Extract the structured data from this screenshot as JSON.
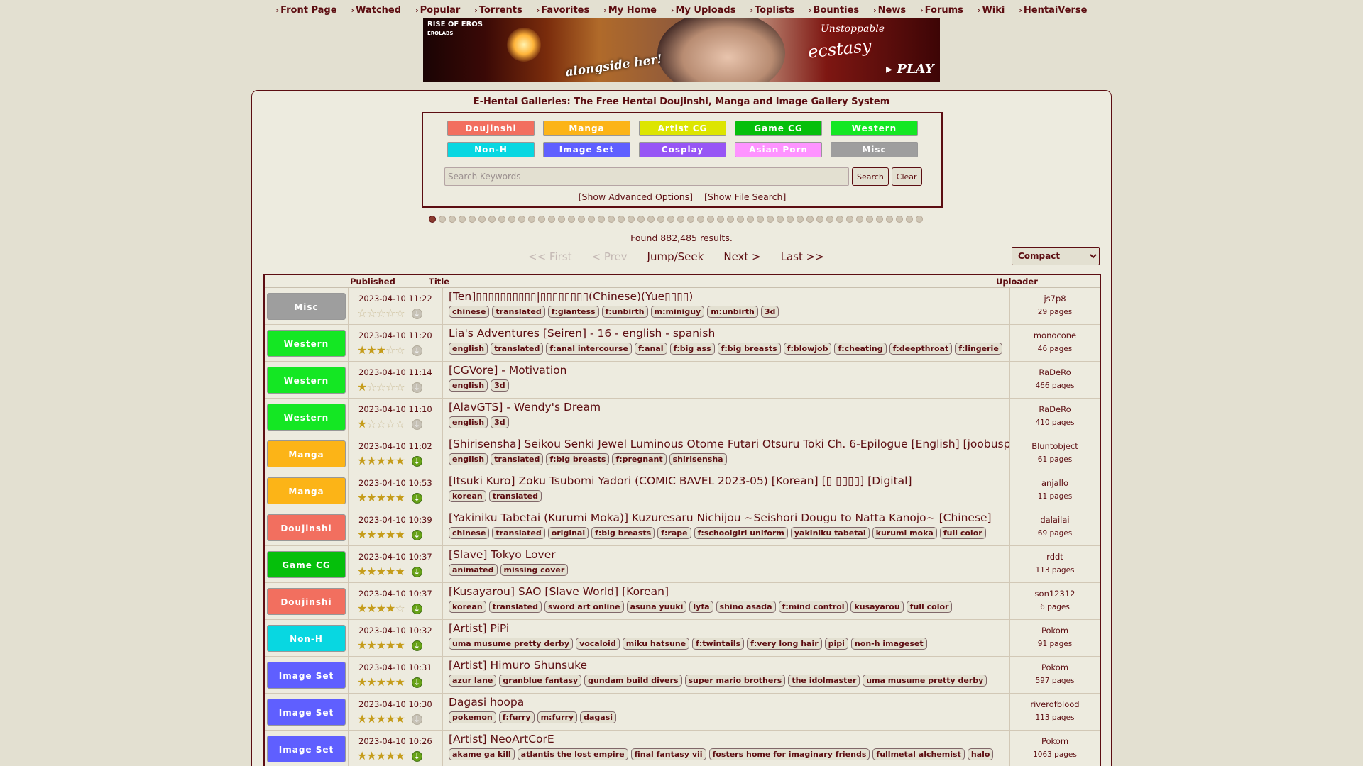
{
  "nav": [
    "Front Page",
    "Watched",
    "Popular",
    "Torrents",
    "Favorites",
    "My Home",
    "My Uploads",
    "Toplists",
    "Bounties",
    "News",
    "Forums",
    "Wiki",
    "HentaiVerse"
  ],
  "banner": {
    "logo": "RISE OF EROS",
    "logo_sub": "EROLABS",
    "line1": "alongside her!",
    "line2": "Unstoppable",
    "line3": "ecstasy",
    "play": "▸ PLAY"
  },
  "site_title": "E-Hentai Galleries: The Free Hentai Doujinshi, Manga and Image Gallery System",
  "categories": [
    {
      "label": "Doujinshi",
      "color": "#f26f5f"
    },
    {
      "label": "Manga",
      "color": "#fcb417"
    },
    {
      "label": "Artist CG",
      "color": "#dde500"
    },
    {
      "label": "Game CG",
      "color": "#05bf0b"
    },
    {
      "label": "Western",
      "color": "#14e723"
    },
    {
      "label": "Non-H",
      "color": "#08d7e1"
    },
    {
      "label": "Image Set",
      "color": "#5f5fff"
    },
    {
      "label": "Cosplay",
      "color": "#9755f5"
    },
    {
      "label": "Asian Porn",
      "color": "#fe93ff"
    },
    {
      "label": "Misc",
      "color": "#9e9e9e"
    }
  ],
  "search": {
    "placeholder": "Search Keywords",
    "value": "",
    "search_label": "Search",
    "clear_label": "Clear"
  },
  "links": {
    "advanced": "[Show Advanced Options]",
    "file": "[Show File Search]"
  },
  "found": "Found 882,485 results.",
  "pager": {
    "first": "<< First",
    "prev": "< Prev",
    "jump": "Jump/Seek",
    "next": "Next >",
    "last": "Last >>"
  },
  "display_mode": "Compact",
  "table_headers": {
    "published": "Published",
    "title": "Title",
    "uploader": "Uploader"
  },
  "cat_colors": {
    "Doujinshi": "#f26f5f",
    "Manga": "#fcb417",
    "Artist CG": "#dde500",
    "Game CG": "#05bf0b",
    "Western": "#14e723",
    "Non-H": "#08d7e1",
    "Image Set": "#5f5fff",
    "Cosplay": "#9755f5",
    "Asian Porn": "#fe93ff",
    "Misc": "#9e9e9e"
  },
  "galleries": [
    {
      "category": "Misc",
      "date": "2023-04-10 11:22",
      "rating": 0,
      "torrent": false,
      "title": "[Ten]▯▯▯▯▯▯▯▯▯▯|▯▯▯▯▯▯▯▯(Chinese)(Yue▯▯▯▯)",
      "tags": [
        "chinese",
        "translated",
        "f:giantess",
        "f:unbirth",
        "m:miniguy",
        "m:unbirth",
        "3d"
      ],
      "uploader": "js7p8",
      "pages": "29 pages"
    },
    {
      "category": "Western",
      "date": "2023-04-10 11:20",
      "rating": 3,
      "torrent": false,
      "title": "Lia's Adventures [Seiren] - 16 - english - spanish",
      "tags": [
        "english",
        "translated",
        "f:anal intercourse",
        "f:anal",
        "f:big ass",
        "f:big breasts",
        "f:blowjob",
        "f:cheating",
        "f:deepthroat",
        "f:lingerie"
      ],
      "uploader": "monocone",
      "pages": "46 pages"
    },
    {
      "category": "Western",
      "date": "2023-04-10 11:14",
      "rating": 1,
      "torrent": false,
      "title": "[CGVore] - Motivation",
      "tags": [
        "english",
        "3d"
      ],
      "uploader": "RaDeRo",
      "pages": "466 pages"
    },
    {
      "category": "Western",
      "date": "2023-04-10 11:10",
      "rating": 1,
      "torrent": false,
      "title": "[AlavGTS] - Wendy's Dream",
      "tags": [
        "english",
        "3d"
      ],
      "uploader": "RaDeRo",
      "pages": "410 pages"
    },
    {
      "category": "Manga",
      "date": "2023-04-10 11:02",
      "rating": 5,
      "torrent": true,
      "title": "[Shirisensha] Seikou Senki Jewel Luminous Otome Futari Otsuru Toki Ch. 6-Epilogue [English] [joobuspaidatl]",
      "tags": [
        "english",
        "translated",
        "f:big breasts",
        "f:pregnant",
        "shirisensha"
      ],
      "uploader": "Bluntobject",
      "pages": "61 pages"
    },
    {
      "category": "Manga",
      "date": "2023-04-10 10:53",
      "rating": 5,
      "torrent": true,
      "title": "[Itsuki Kuro] Zoku Tsubomi Yadori (COMIC BAVEL 2023-05) [Korean] [▯ ▯▯▯▯] [Digital]",
      "tags": [
        "korean",
        "translated"
      ],
      "uploader": "anjallo",
      "pages": "11 pages"
    },
    {
      "category": "Doujinshi",
      "date": "2023-04-10 10:39",
      "rating": 5,
      "torrent": true,
      "title": "[Yakiniku Tabetai (Kurumi Moka)] Kuzuresaru Nichijou ~Seishori Dougu to Natta Kanojo~ [Chinese]",
      "tags": [
        "chinese",
        "translated",
        "original",
        "f:big breasts",
        "f:rape",
        "f:schoolgirl uniform",
        "yakiniku tabetai",
        "kurumi moka",
        "full color"
      ],
      "uploader": "dalailai",
      "pages": "69 pages"
    },
    {
      "category": "Game CG",
      "date": "2023-04-10 10:37",
      "rating": 5,
      "torrent": true,
      "title": "[Slave] Tokyo Lover",
      "tags": [
        "animated",
        "missing cover"
      ],
      "uploader": "rddt",
      "pages": "113 pages"
    },
    {
      "category": "Doujinshi",
      "date": "2023-04-10 10:37",
      "rating": 4,
      "torrent": true,
      "title": "[Kusayarou] SAO [Slave World] [Korean]",
      "tags": [
        "korean",
        "translated",
        "sword art online",
        "asuna yuuki",
        "lyfa",
        "shino asada",
        "f:mind control",
        "kusayarou",
        "full color"
      ],
      "uploader": "son12312",
      "pages": "6 pages"
    },
    {
      "category": "Non-H",
      "date": "2023-04-10 10:32",
      "rating": 5,
      "torrent": true,
      "title": "[Artist] PiPi",
      "tags": [
        "uma musume pretty derby",
        "vocaloid",
        "miku hatsune",
        "f:twintails",
        "f:very long hair",
        "pipi",
        "non-h imageset"
      ],
      "uploader": "Pokom",
      "pages": "91 pages"
    },
    {
      "category": "Image Set",
      "date": "2023-04-10 10:31",
      "rating": 5,
      "torrent": true,
      "title": "[Artist] Himuro Shunsuke",
      "tags": [
        "azur lane",
        "granblue fantasy",
        "gundam build divers",
        "super mario brothers",
        "the idolmaster",
        "uma musume pretty derby"
      ],
      "uploader": "Pokom",
      "pages": "597 pages"
    },
    {
      "category": "Image Set",
      "date": "2023-04-10 10:30",
      "rating": 5,
      "torrent": false,
      "title": "Dagasi hoopa",
      "tags": [
        "pokemon",
        "f:furry",
        "m:furry",
        "dagasi"
      ],
      "uploader": "riverofblood",
      "pages": "113 pages"
    },
    {
      "category": "Image Set",
      "date": "2023-04-10 10:26",
      "rating": 5,
      "torrent": true,
      "title": "[Artist] NeoArtCorE",
      "tags": [
        "akame ga kill",
        "atlantis the lost empire",
        "final fantasy vii",
        "fosters home for imaginary friends",
        "fullmetal alchemist",
        "halo"
      ],
      "uploader": "Pokom",
      "pages": "1063 pages"
    }
  ]
}
